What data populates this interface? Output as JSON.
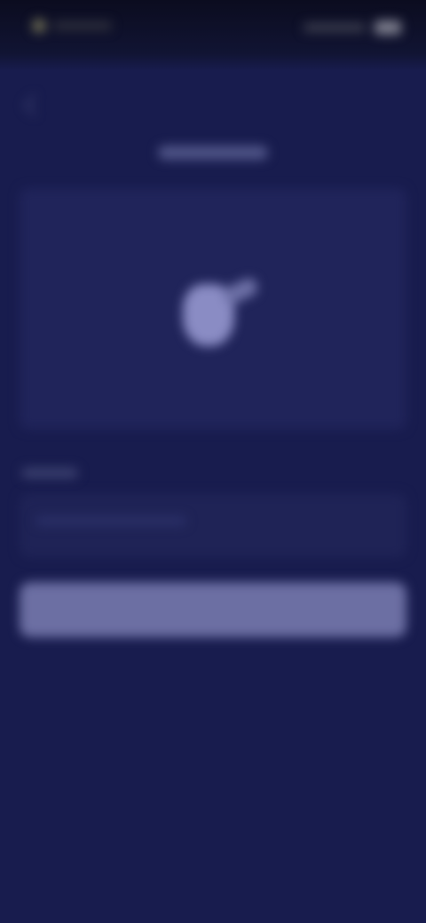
{
  "colors": {
    "background": "#181c4e",
    "status_bar": "#0b0c1f",
    "card": "#20245a",
    "button": "#6c6fa3",
    "illustration": "#8a8cc4"
  },
  "icons": {
    "back": "back-arrow-icon",
    "battery": "battery-icon",
    "signal": "signal-icon"
  },
  "header": {
    "title": ""
  },
  "section": {
    "label": ""
  },
  "info": {
    "text": ""
  },
  "button": {
    "label": ""
  }
}
